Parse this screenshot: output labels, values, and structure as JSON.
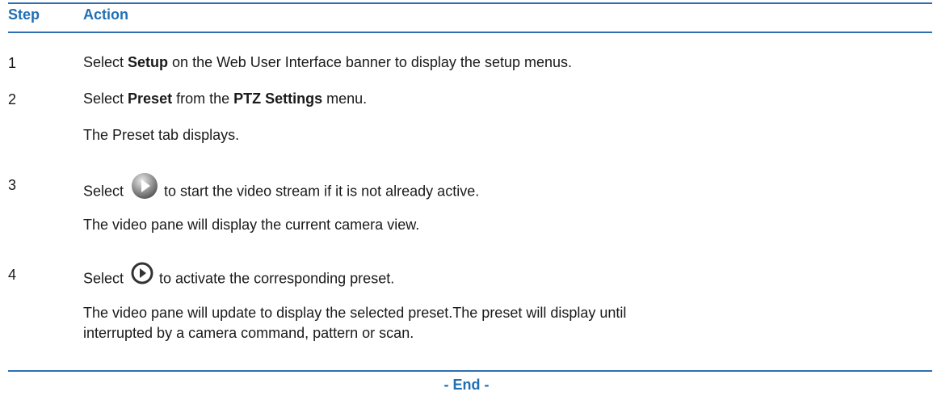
{
  "table": {
    "headers": {
      "step": "Step",
      "action": "Action"
    },
    "rows": [
      {
        "num": "1",
        "pre": "Select ",
        "bold1": "Setup",
        "post": " on the Web User Interface banner to display the setup menus."
      },
      {
        "num": "2",
        "pre": "Select ",
        "bold1": "Preset",
        "mid": " from the ",
        "bold2": "PTZ Settings",
        "post": " menu.",
        "result": "The Preset tab displays."
      },
      {
        "num": "3",
        "pre": "Select",
        "icon": "play-button-icon",
        "post": "to start the video stream if it is not already active.",
        "result": "The video pane will display the current camera view."
      },
      {
        "num": "4",
        "pre": "Select",
        "icon": "activate-preset-icon",
        "post": "to activate the corresponding preset.",
        "result_line1": "The video pane will update to display the selected preset.The preset will display until",
        "result_line2": "interrupted by a camera command, pattern or scan."
      }
    ]
  },
  "footer": {
    "end_label": "- End -"
  },
  "colors": {
    "heading": "#1f6fb5",
    "rule": "#2f6fb1",
    "text": "#1a1a1a"
  }
}
